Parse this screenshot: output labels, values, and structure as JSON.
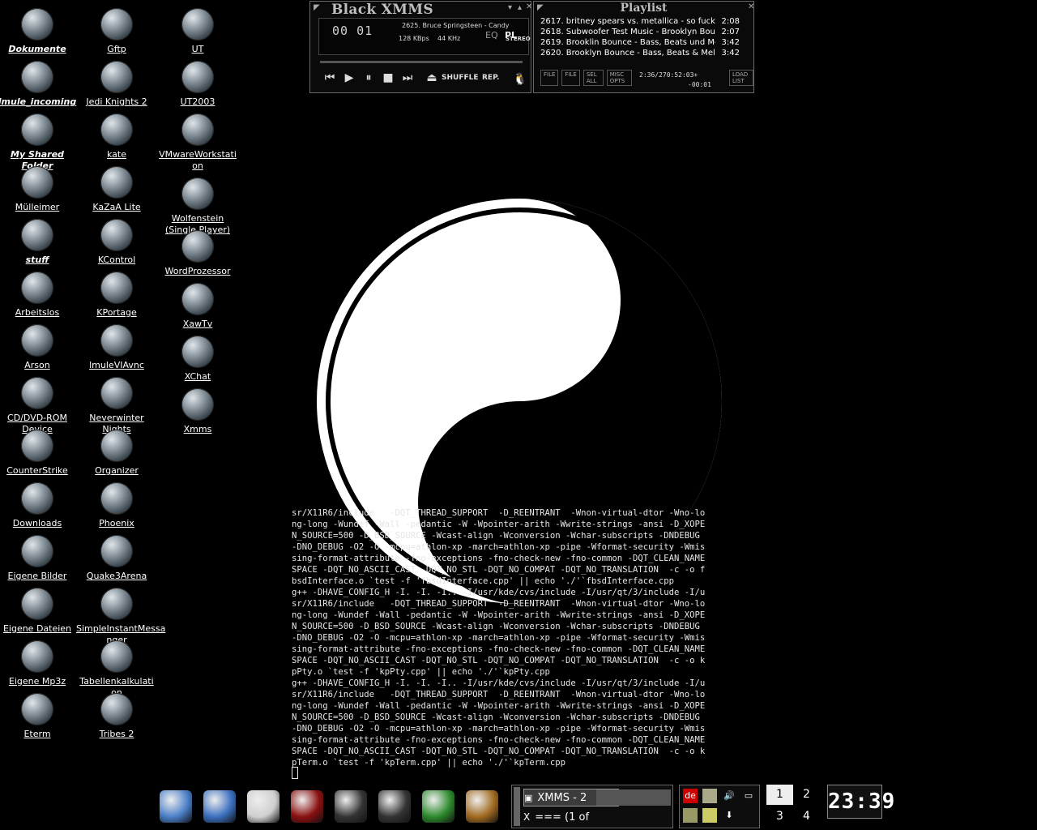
{
  "desktop": {
    "col1": [
      {
        "label": "Dokumente",
        "icon": "documents-icon",
        "bold": true
      },
      {
        "label": "lmule_incoming",
        "icon": "lmule-icon",
        "bold": true
      },
      {
        "label": "My Shared Folder",
        "icon": "kazaa-icon",
        "bold": true
      },
      {
        "label": "Mülleimer",
        "icon": "trash-icon"
      },
      {
        "label": "stuff",
        "icon": "question-icon",
        "bold": true
      },
      {
        "label": "Arbeitslos",
        "icon": "home-icon"
      },
      {
        "label": "Arson",
        "icon": "arson-icon"
      },
      {
        "label": "CD/DVD-ROM",
        "label2": "Device",
        "icon": "cdrom-icon"
      },
      {
        "label": "CounterStrike",
        "icon": "counterstrike-icon"
      },
      {
        "label": "Downloads",
        "icon": "downloads-icon"
      },
      {
        "label": "Eigene Bilder",
        "icon": "penguin-icon"
      },
      {
        "label": "Eigene Dateien",
        "icon": "skull-icon"
      },
      {
        "label": "Eigene Mp3z",
        "icon": "mp3-icon"
      },
      {
        "label": "Eterm",
        "icon": "terminal-icon"
      }
    ],
    "col2": [
      {
        "label": "Gftp",
        "icon": "gftp-icon"
      },
      {
        "label": "Jedi Knights 2",
        "icon": "jedi-icon"
      },
      {
        "label": "kate",
        "icon": "kate-icon"
      },
      {
        "label": "KaZaA Lite",
        "icon": "kazaa-icon"
      },
      {
        "label": "KControl",
        "icon": "kcontrol-icon"
      },
      {
        "label": "KPortage",
        "icon": "portage-icon"
      },
      {
        "label": "lmuleVIAvnc",
        "icon": "lmule-icon"
      },
      {
        "label": "Neverwinter Nights",
        "icon": "neverwinter-icon"
      },
      {
        "label": "Organizer",
        "icon": "organizer-icon"
      },
      {
        "label": "Phoenix",
        "icon": "phoenix-icon"
      },
      {
        "label": "Quake3Arena",
        "icon": "quake-icon"
      },
      {
        "label": "SimpleInstantMessa",
        "label2": "nger",
        "icon": "sim-icon"
      },
      {
        "label": "Tabellenkalkulati",
        "label2": "on",
        "icon": "spreadsheet-icon"
      },
      {
        "label": "Tribes 2",
        "icon": "tribes-icon"
      }
    ],
    "col3": [
      {
        "label": "UT",
        "icon": "ut-icon"
      },
      {
        "label": "UT2003",
        "icon": "ut-icon"
      },
      {
        "label": "VMwareWorkstati",
        "label2": "on",
        "icon": "vmware-icon"
      },
      {
        "label": "Wolfenstein",
        "label2": "(Single Player)",
        "icon": "wolfenstein-icon"
      },
      {
        "label": "WordProzessor",
        "icon": "wordprocessor-icon"
      },
      {
        "label": "XawTv",
        "icon": "tv-icon"
      },
      {
        "label": "XChat",
        "icon": "xchat-icon"
      },
      {
        "label": "Xmms",
        "icon": "xmms-icon"
      }
    ]
  },
  "xmms": {
    "title": "Black XMMS",
    "time": "00 01",
    "song": "2625. Bruce Springsteen - Candy",
    "kbps": "128 KBps",
    "khz": "44 KHz",
    "stereo": "STEREO",
    "eq": "EQ",
    "pl": "PL",
    "shuffle": "SHUFFLE",
    "repeat": "REP."
  },
  "playlist": {
    "title": "Playlist",
    "items": [
      {
        "title": "2617. britney spears vs. metallica - so fuckin...",
        "dur": "2:08"
      },
      {
        "title": "2618. Subwoofer Test Music - Brooklyn Bou...",
        "dur": "2:07"
      },
      {
        "title": "2619. Brooklin Bounce - Bass, Beats und Me...",
        "dur": "3:42"
      },
      {
        "title": "2620. Brooklyn Bounce - Bass, Beats & Melo...",
        "dur": "3:42"
      }
    ],
    "buttons": [
      "FILE",
      "FILE",
      "SEL ALL",
      "MISC OPTS",
      "LOAD LIST"
    ],
    "time": "2:36/270:52:03+",
    "elapsed": "-00:01"
  },
  "terminal": {
    "lines": [
      "sr/X11R6/include   -DQT_THREAD_SUPPORT  -D_REENTRANT  -Wnon-virtual-dtor -Wno-lo",
      "ng-long -Wundef -Wall -pedantic -W -Wpointer-arith -Wwrite-strings -ansi -D_XOPE",
      "N_SOURCE=500 -D_BSD_SOURCE -Wcast-align -Wconversion -Wchar-subscripts -DNDEBUG",
      "-DNO_DEBUG -O2 -O -mcpu=athlon-xp -march=athlon-xp -pipe -Wformat-security -Wmis",
      "sing-format-attribute -fno-exceptions -fno-check-new -fno-common -DQT_CLEAN_NAME",
      "SPACE -DQT_NO_ASCII_CAST -DQT_NO_STL -DQT_NO_COMPAT -DQT_NO_TRANSLATION  -c -o f",
      "bsdInterface.o `test -f 'fbsdInterface.cpp' || echo './'`fbsdInterface.cpp",
      "g++ -DHAVE_CONFIG_H -I. -I. -I.. -I/usr/kde/cvs/include -I/usr/qt/3/include -I/u",
      "sr/X11R6/include   -DQT_THREAD_SUPPORT  -D_REENTRANT  -Wnon-virtual-dtor -Wno-lo",
      "ng-long -Wundef -Wall -pedantic -W -Wpointer-arith -Wwrite-strings -ansi -D_XOPE",
      "N_SOURCE=500 -D_BSD_SOURCE -Wcast-align -Wconversion -Wchar-subscripts -DNDEBUG",
      "-DNO_DEBUG -O2 -O -mcpu=athlon-xp -march=athlon-xp -pipe -Wformat-security -Wmis",
      "sing-format-attribute -fno-exceptions -fno-check-new -fno-common -DQT_CLEAN_NAME",
      "SPACE -DQT_NO_ASCII_CAST -DQT_NO_STL -DQT_NO_COMPAT -DQT_NO_TRANSLATION  -c -o k",
      "pPty.o `test -f 'kpPty.cpp' || echo './'`kpPty.cpp",
      "g++ -DHAVE_CONFIG_H -I. -I. -I.. -I/usr/kde/cvs/include -I/usr/qt/3/include -I/u",
      "sr/X11R6/include   -DQT_THREAD_SUPPORT  -D_REENTRANT  -Wnon-virtual-dtor -Wno-lo",
      "ng-long -Wundef -Wall -pedantic -W -Wpointer-arith -Wwrite-strings -ansi -D_XOPE",
      "N_SOURCE=500 -D_BSD_SOURCE -Wcast-align -Wconversion -Wchar-subscripts -DNDEBUG",
      "-DNO_DEBUG -O2 -O -mcpu=athlon-xp -march=athlon-xp -pipe -Wformat-security -Wmis",
      "sing-format-attribute -fno-exceptions -fno-check-new -fno-common -DQT_CLEAN_NAME",
      "SPACE -DQT_NO_ASCII_CAST -DQT_NO_STL -DQT_NO_COMPAT -DQT_NO_TRANSLATION  -c -o k",
      "pTerm.o `test -f 'kpTerm.cpp' || echo './'`kpTerm.cpp"
    ]
  },
  "taskbar": {
    "dock": [
      "finder-icon",
      "desktop-icon",
      "tux-icon",
      "phoenix-icon",
      "terminal-icon",
      "xmms-icon",
      "kazaa-icon",
      "arson-icon"
    ],
    "tasks": [
      {
        "label": "XMMS - 2",
        "icon": "xmms-icon",
        "active": true
      },
      {
        "label": "=== (1 of",
        "icon": "x-icon",
        "active": false
      }
    ],
    "tray": {
      "lang": "de"
    },
    "pager": [
      "1",
      "2",
      "3",
      "4"
    ],
    "clock": "23:39",
    "colors": {
      "panel": "#0d0d0d",
      "active_task": "#3c3c3c"
    }
  }
}
